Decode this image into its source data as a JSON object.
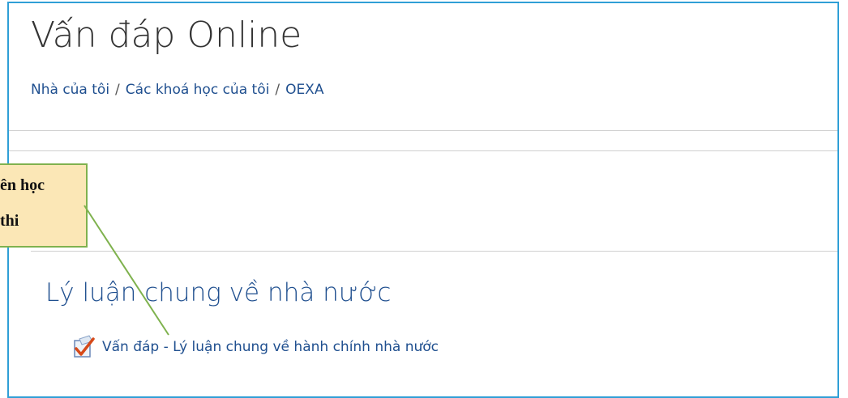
{
  "page": {
    "title": "Vấn đáp Online"
  },
  "breadcrumb": {
    "items": [
      "Nhà của tôi",
      "Các khoá học của tôi",
      "OEXA"
    ],
    "separator": "/"
  },
  "section": {
    "title": "Lý luận chung về nhà nước",
    "activity": {
      "icon": "quiz-checkbox-icon",
      "label": "Vấn đáp - Lý luận chung về hành chính nhà nước"
    }
  },
  "callout": {
    "line1": "ên học",
    "line2": "thi"
  },
  "colors": {
    "frame_border": "#2f9fd6",
    "link": "#1f4f8f",
    "callout_fill": "#fbe7b6",
    "callout_border": "#7fb24e",
    "leader_line": "#7fb24e",
    "divider": "#cfcfcf"
  }
}
